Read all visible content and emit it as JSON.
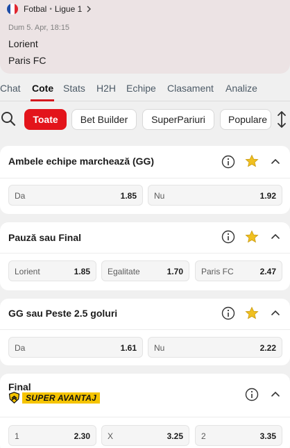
{
  "event": {
    "sport": "Fotbal",
    "league": "Ligue 1",
    "datetime": "Dum 5. Apr, 18:15",
    "home": "Lorient",
    "away": "Paris FC",
    "flag_colors": [
      "#1f4ea8",
      "#ffffff",
      "#e0262f"
    ]
  },
  "tabs": [
    {
      "label": "Chat"
    },
    {
      "label": "Cote",
      "active": true
    },
    {
      "label": "Stats"
    },
    {
      "label": "H2H"
    },
    {
      "label": "Echipe"
    },
    {
      "label": "Clasament"
    },
    {
      "label": "Analize"
    }
  ],
  "filters": [
    {
      "label": "Toate",
      "active": true
    },
    {
      "label": "Bet Builder"
    },
    {
      "label": "SuperPariuri"
    },
    {
      "label": "Populare"
    }
  ],
  "markets": [
    {
      "title": "Ambele echipe marchează (GG)",
      "favorite": true,
      "odds": [
        {
          "label": "Da",
          "value": "1.85"
        },
        {
          "label": "Nu",
          "value": "1.92"
        }
      ]
    },
    {
      "title": "Pauză sau Final",
      "favorite": true,
      "odds": [
        {
          "label": "Lorient",
          "value": "1.85"
        },
        {
          "label": "Egalitate",
          "value": "1.70"
        },
        {
          "label": "Paris FC",
          "value": "2.47"
        }
      ]
    },
    {
      "title": "GG sau Peste 2.5 goluri",
      "favorite": true,
      "odds": [
        {
          "label": "Da",
          "value": "1.61"
        },
        {
          "label": "Nu",
          "value": "2.22"
        }
      ]
    },
    {
      "title": "Final",
      "badge": "SUPER AVANTAJ",
      "odds": [
        {
          "label": "1",
          "value": "2.30"
        },
        {
          "label": "X",
          "value": "3.25"
        },
        {
          "label": "2",
          "value": "3.35"
        }
      ]
    }
  ],
  "colors": {
    "accent": "#e3141b",
    "header_bg": "#ece3e4",
    "star": "#f0c020",
    "badge": "#f5c400"
  },
  "icons": [
    "chevron-right-icon",
    "search-icon",
    "sort-icon",
    "info-icon",
    "star-icon",
    "chevron-up-icon",
    "shield-icon"
  ]
}
